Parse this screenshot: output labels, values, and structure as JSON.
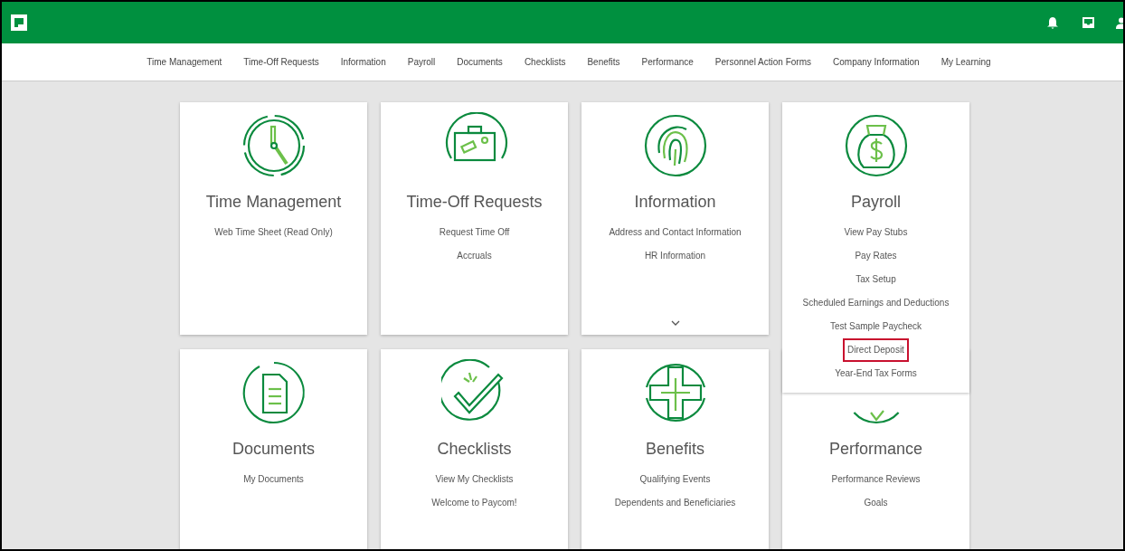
{
  "nav": [
    "Time Management",
    "Time-Off Requests",
    "Information",
    "Payroll",
    "Documents",
    "Checklists",
    "Benefits",
    "Performance",
    "Personnel Action Forms",
    "Company Information",
    "My Learning"
  ],
  "cards": [
    {
      "title": "Time Management",
      "expanded": false,
      "links": [
        {
          "label": "Web Time Sheet (Read Only)",
          "highlighted": false
        }
      ]
    },
    {
      "title": "Time-Off Requests",
      "expanded": false,
      "links": [
        {
          "label": "Request Time Off",
          "highlighted": false
        },
        {
          "label": "Accruals",
          "highlighted": false
        }
      ]
    },
    {
      "title": "Information",
      "expanded": false,
      "more": true,
      "links": [
        {
          "label": "Address and Contact Information",
          "highlighted": false
        },
        {
          "label": "HR Information",
          "highlighted": false
        }
      ]
    },
    {
      "title": "Payroll",
      "expanded": true,
      "links": [
        {
          "label": "View Pay Stubs",
          "highlighted": false
        },
        {
          "label": "Pay Rates",
          "highlighted": false
        },
        {
          "label": "Tax Setup",
          "highlighted": false
        },
        {
          "label": "Scheduled Earnings and Deductions",
          "highlighted": false
        },
        {
          "label": "Test Sample Paycheck",
          "highlighted": false
        },
        {
          "label": "Direct Deposit",
          "highlighted": true
        },
        {
          "label": "Year-End Tax Forms",
          "highlighted": false
        }
      ]
    },
    {
      "title": "Documents",
      "expanded": false,
      "links": [
        {
          "label": "My Documents",
          "highlighted": false
        }
      ]
    },
    {
      "title": "Checklists",
      "expanded": false,
      "links": [
        {
          "label": "View My Checklists",
          "highlighted": false
        },
        {
          "label": "Welcome to Paycom!",
          "highlighted": false
        }
      ]
    },
    {
      "title": "Benefits",
      "expanded": false,
      "links": [
        {
          "label": "Qualifying Events",
          "highlighted": false
        },
        {
          "label": "Dependents and Beneficiaries",
          "highlighted": false
        }
      ]
    },
    {
      "title": "Performance",
      "expanded": false,
      "links": [
        {
          "label": "Performance Reviews",
          "highlighted": false
        },
        {
          "label": "Goals",
          "highlighted": false
        }
      ]
    }
  ]
}
